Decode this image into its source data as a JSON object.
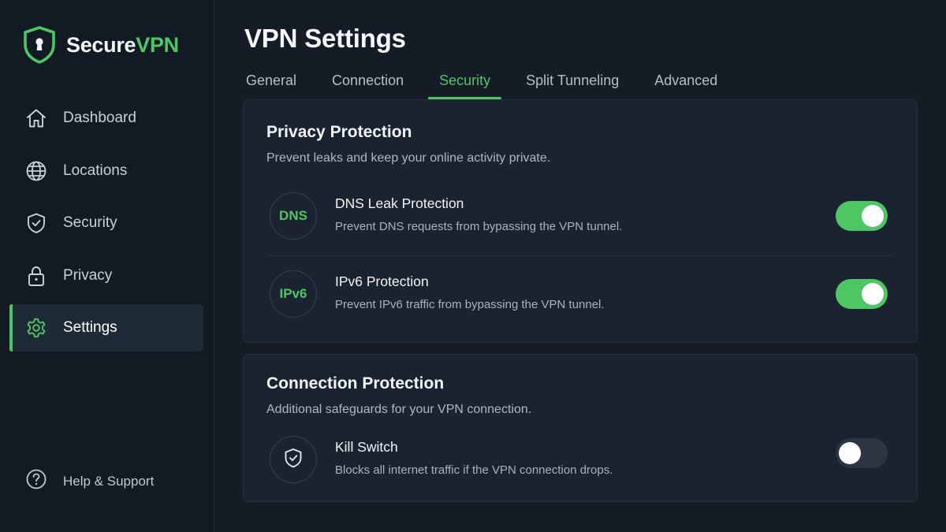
{
  "brand": {
    "name_primary": "Secure",
    "name_accent": "VPN"
  },
  "sidebar": {
    "items": [
      {
        "label": "Dashboard",
        "icon": "home-icon",
        "active": false
      },
      {
        "label": "Locations",
        "icon": "globe-icon",
        "active": false
      },
      {
        "label": "Security",
        "icon": "shield-check-icon",
        "active": false
      },
      {
        "label": "Privacy",
        "icon": "lock-icon",
        "active": false
      },
      {
        "label": "Settings",
        "icon": "gear-icon",
        "active": true
      }
    ],
    "help": {
      "label": "Help & Support",
      "icon": "question-circle-icon"
    }
  },
  "main": {
    "title": "VPN Settings",
    "tabs": [
      {
        "label": "General",
        "active": false
      },
      {
        "label": "Connection",
        "active": false
      },
      {
        "label": "Security",
        "active": true
      },
      {
        "label": "Split Tunneling",
        "active": false
      },
      {
        "label": "Advanced",
        "active": false
      }
    ],
    "privacy_card": {
      "title": "Privacy Protection",
      "description": "Prevent leaks and keep your online activity private.",
      "rows": [
        {
          "badge": "DNS",
          "name": "DNS Leak Protection",
          "description": "Prevent DNS requests from bypassing the VPN tunnel.",
          "enabled": true
        },
        {
          "badge": "IPv6",
          "name": "IPv6 Protection",
          "description": "Prevent IPv6 traffic from bypassing the VPN tunnel.",
          "enabled": true
        }
      ]
    },
    "connection_card": {
      "title": "Connection Protection",
      "description": "Additional safeguards for your VPN connection.",
      "rows": [
        {
          "icon": "shield-check-icon",
          "name": "Kill Switch",
          "description": "Blocks all internet traffic if the VPN connection drops.",
          "enabled": false
        }
      ]
    }
  },
  "colors": {
    "accent": "#4cc764",
    "background": "#151c26",
    "sidebar": "#121a24",
    "card": "#1a232f",
    "toggle_off": "#2c3541"
  }
}
